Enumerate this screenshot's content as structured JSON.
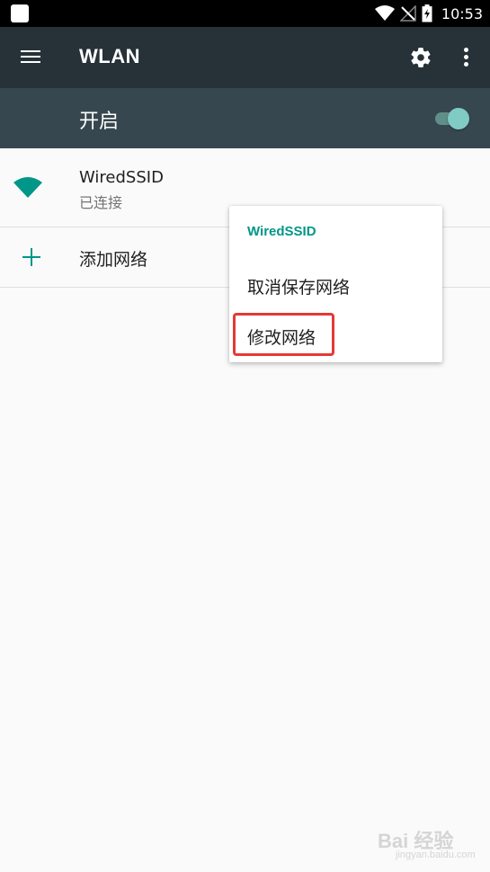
{
  "status_bar": {
    "time": "10:53",
    "icons": [
      "wifi-icon",
      "no-signal-icon",
      "battery-charging-icon"
    ]
  },
  "toolbar": {
    "title": "WLAN",
    "menu_icon": "hamburger-menu-icon",
    "settings_icon": "gear-icon",
    "overflow_icon": "more-vert-icon"
  },
  "master_switch": {
    "label": "开启",
    "state": "on"
  },
  "networks": [
    {
      "ssid": "WiredSSID",
      "status": "已连接",
      "icon": "wifi-full-icon"
    }
  ],
  "add_network": {
    "label": "添加网络",
    "icon": "plus-icon"
  },
  "context_menu": {
    "title": "WiredSSID",
    "items": [
      {
        "label": "取消保存网络"
      },
      {
        "label": "修改网络"
      }
    ],
    "highlighted_item": "修改网络"
  },
  "watermark": {
    "text": "Bai 经验",
    "sub": "jingyan.baidu.com"
  },
  "colors": {
    "toolbar": "#263238",
    "switch_bar": "#37474f",
    "accent": "#009688",
    "highlight": "#e53935"
  }
}
